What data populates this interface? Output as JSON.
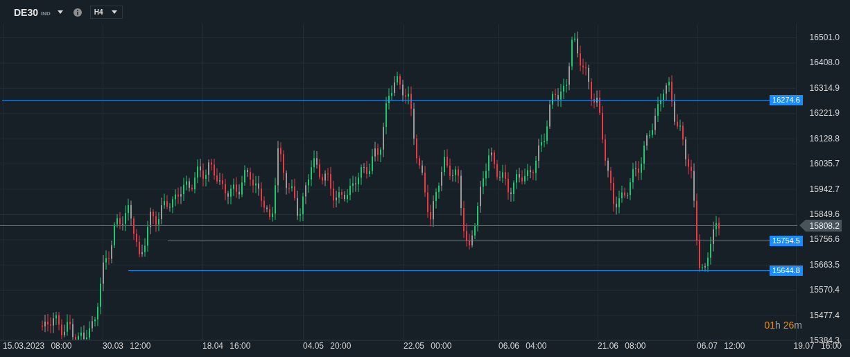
{
  "header": {
    "symbol": "DE30",
    "market": "IND",
    "timeframe": "H4"
  },
  "price_axis": [
    "16501.0",
    "16408.0",
    "16314.9",
    "16221.9",
    "16128.8",
    "16035.7",
    "15942.7",
    "15849.6",
    "15756.6",
    "15663.5",
    "15570.4",
    "15477.4",
    "15384.3"
  ],
  "time_axis": [
    "15.03.2023 08:00",
    "30.03 12:00",
    "18.04 16:00",
    "04.05 20:00",
    "22.05 00:00",
    "06.06 04:00",
    "21.06 08:00",
    "06.07 12:00",
    "19.07 16:00"
  ],
  "levels": [
    {
      "label": "16274.6"
    },
    {
      "label": "15754.5"
    },
    {
      "label": "15644.8"
    }
  ],
  "current_price": "15808.2",
  "countdown": {
    "hours": "01",
    "hours_unit": "h",
    "minutes": "26",
    "minutes_unit": "m"
  }
}
